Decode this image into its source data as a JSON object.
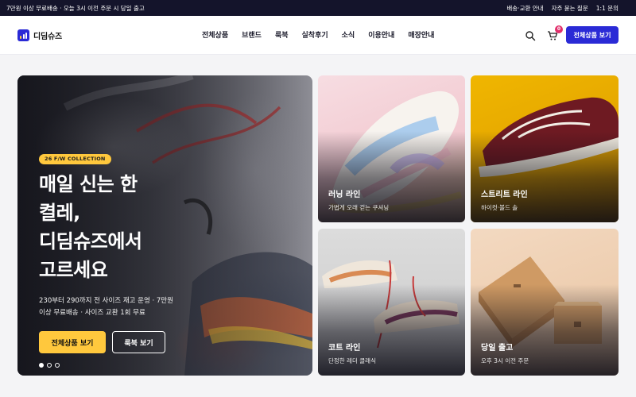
{
  "topbar": {
    "announcement": "7만원 이상 무료배송 · 오늘 3시 이전 주문 시 당일 출고",
    "links": [
      "배송·교환 안내",
      "자주 묻는 질문",
      "1:1 문의"
    ]
  },
  "header": {
    "logo_text": "디딤슈즈",
    "nav": [
      "전체상품",
      "브랜드",
      "룩북",
      "실착후기",
      "소식",
      "이용안내",
      "매장안내"
    ],
    "icons": [
      "search-icon",
      "cart-icon"
    ],
    "cart_count": "0",
    "cta_label": "전체상품 보기",
    "accent_color": "#2a2ad6"
  },
  "hero": {
    "badge": "26 F/W COLLECTION",
    "title_lines": [
      "매일 신는 한",
      "켤레,",
      "디딤슈즈에서",
      "고르세요"
    ],
    "subtitle_lines": [
      "230부터 290까지 전 사이즈 재고 운영 · 7만원",
      "이상 무료배송 · 사이즈 교환 1회 무료"
    ],
    "primary_button": "전체상품 보기",
    "secondary_button": "룩북 보기",
    "slides": 3,
    "active_slide": 1,
    "highlight_color": "#ffc83d"
  },
  "cards": [
    {
      "title": "러닝 라인",
      "subtitle": "가볍게 오래 걷는 쿠셔닝"
    },
    {
      "title": "스트리트 라인",
      "subtitle": "하이컷·볼드 솔"
    },
    {
      "title": "코트 라인",
      "subtitle": "단정한 레더 클래식"
    },
    {
      "title": "당일 출고",
      "subtitle": "오후 3시 이전 주문"
    }
  ]
}
